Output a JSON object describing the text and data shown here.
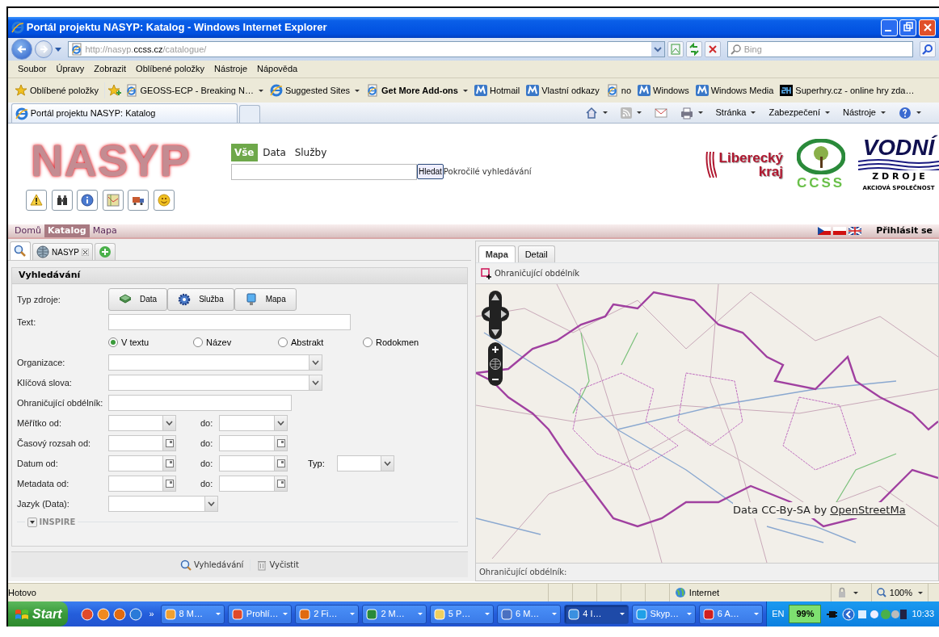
{
  "window": {
    "title": "Portál projektu NASYP: Katalog - Windows Internet Explorer"
  },
  "address_bar": {
    "url_parts": [
      {
        "text": "http://nasyp.",
        "kind": "dim"
      },
      {
        "text": "ccss.cz",
        "kind": "host"
      },
      {
        "text": "/catalogue/",
        "kind": "dim"
      }
    ]
  },
  "search_box": {
    "placeholder": "Bing"
  },
  "menu": [
    "Soubor",
    "Úpravy",
    "Zobrazit",
    "Oblíbené položky",
    "Nástroje",
    "Nápověda"
  ],
  "favorites_bar": {
    "label": "Oblíbené položky",
    "items": [
      {
        "label": "GEOSS-ECP - Breaking N…",
        "kind": "page",
        "dropdown": true,
        "bold": false
      },
      {
        "label": "Suggested Sites",
        "kind": "ie",
        "dropdown": true,
        "bold": false
      },
      {
        "label": "Get More Add-ons",
        "kind": "page",
        "dropdown": true,
        "bold": true
      },
      {
        "label": "Hotmail",
        "kind": "m",
        "dropdown": false,
        "bold": false
      },
      {
        "label": "Vlastní odkazy",
        "kind": "m",
        "dropdown": false,
        "bold": false
      },
      {
        "label": "no",
        "kind": "page",
        "dropdown": false,
        "bold": false
      },
      {
        "label": "Windows",
        "kind": "m",
        "dropdown": false,
        "bold": false
      },
      {
        "label": "Windows Media",
        "kind": "m",
        "dropdown": false,
        "bold": false
      },
      {
        "label": "Superhry.cz - online hry zda…",
        "kind": "sh",
        "dropdown": false,
        "bold": false
      }
    ]
  },
  "browser_tab": {
    "label": "Portál projektu NASYP: Katalog"
  },
  "command_bar": [
    "Stránka",
    "Zabezpečení",
    "Nástroje"
  ],
  "site": {
    "logo": "NASYP",
    "tool_buttons": [
      {
        "kind": "warning"
      },
      {
        "kind": "binoculars"
      },
      {
        "kind": "info"
      },
      {
        "kind": "map"
      },
      {
        "kind": "truck"
      },
      {
        "kind": "smiley"
      }
    ],
    "scope_tabs": [
      {
        "label": "Vše",
        "selected": true
      },
      {
        "label": "Data",
        "selected": false
      },
      {
        "label": "Služby",
        "selected": false
      }
    ],
    "search_button": "Hledat",
    "advanced_link": "Pokročilé vyhledávání",
    "partners": [
      {
        "kind": "liberec",
        "lines": [
          "Liberecký",
          "kraj"
        ]
      },
      {
        "kind": "ccss",
        "lines": [
          "CCSS"
        ]
      },
      {
        "kind": "vodni",
        "lines": [
          "VODNÍ",
          "Z D R O J E",
          "AKCIOVÁ SPOLEČNOST"
        ]
      }
    ],
    "nav": [
      {
        "label": "Domů",
        "selected": false
      },
      {
        "label": "Katalog",
        "selected": true
      },
      {
        "label": "Mapa",
        "selected": false
      }
    ],
    "login": "Přihlásit se"
  },
  "left_tabs": [
    {
      "kind": "search",
      "selected": true
    },
    {
      "kind": "named",
      "label": "NASYP",
      "selected": false
    },
    {
      "kind": "add",
      "selected": false
    }
  ],
  "search_form": {
    "title": "Vyhledávání",
    "resource_type": {
      "label": "Typ zdroje:",
      "buttons": [
        {
          "label": "Data",
          "kind": "data"
        },
        {
          "label": "Služba",
          "kind": "service"
        },
        {
          "label": "Mapa",
          "kind": "map"
        }
      ]
    },
    "text": {
      "label": "Text:"
    },
    "text_modes": [
      {
        "label": "V textu",
        "selected": true
      },
      {
        "label": "Název",
        "selected": false
      },
      {
        "label": "Abstrakt",
        "selected": false
      },
      {
        "label": "Rodokmen",
        "selected": false
      }
    ],
    "fields": [
      {
        "label": "Organizace:",
        "kind": "combo"
      },
      {
        "label": "Klíčová slova:",
        "kind": "combo"
      },
      {
        "label": "Ohraničující obdélník:",
        "kind": "text"
      },
      {
        "label": "Měřítko od:",
        "kind": "combo-range",
        "to_label": "do:"
      },
      {
        "label": "Časový rozsah od:",
        "kind": "date-range",
        "to_label": "do:"
      },
      {
        "label": "Datum od:",
        "kind": "date-range",
        "to_label": "do:",
        "extra_label": "Typ:"
      },
      {
        "label": "Metadata od:",
        "kind": "date-range",
        "to_label": "do:"
      },
      {
        "label": "Jazyk (Data):",
        "kind": "combo-short"
      }
    ],
    "section": {
      "label": "INSPIRE",
      "expanded": false
    },
    "actions": [
      {
        "label": "Vyhledávání",
        "kind": "search"
      },
      {
        "label": "Vyčistit",
        "kind": "clear"
      }
    ]
  },
  "map_panel": {
    "tabs": [
      {
        "label": "Mapa",
        "selected": true
      },
      {
        "label": "Detail",
        "selected": false
      }
    ],
    "tool": "Ohraničující obdélník",
    "attribution": "Data CC-By-SA by ",
    "attribution_link": "OpenStreetMa",
    "footer": "Ohraničující obdélník:"
  },
  "status_bar": {
    "text": "Hotovo",
    "zone": "Internet",
    "zoom": "100%"
  },
  "taskbar": {
    "start": "Start",
    "quick_launch": [
      {
        "color": "#e04a2a"
      },
      {
        "color": "#f08a20"
      },
      {
        "color": "#e06a10"
      },
      {
        "color": "#2a7ad8"
      }
    ],
    "more": "»",
    "tasks": [
      {
        "label": "8 M…",
        "color": "#f0a030",
        "selected": false
      },
      {
        "label": "Prohlí…",
        "color": "#e04a2a",
        "selected": false
      },
      {
        "label": "2 Fi…",
        "color": "#e06a10",
        "selected": false
      },
      {
        "label": "2 M…",
        "color": "#2a8a3a",
        "selected": false
      },
      {
        "label": "5 P…",
        "color": "#f0d060",
        "selected": false
      },
      {
        "label": "6 M…",
        "color": "#4a70c0",
        "selected": false
      },
      {
        "label": "4 I…",
        "color": "#3a90e0",
        "selected": true
      },
      {
        "label": "Skyp…",
        "color": "#20a0e8",
        "selected": false
      },
      {
        "label": "6 A…",
        "color": "#d02020",
        "selected": false
      }
    ],
    "language": "EN",
    "battery": "99%",
    "clock": "10:33"
  }
}
